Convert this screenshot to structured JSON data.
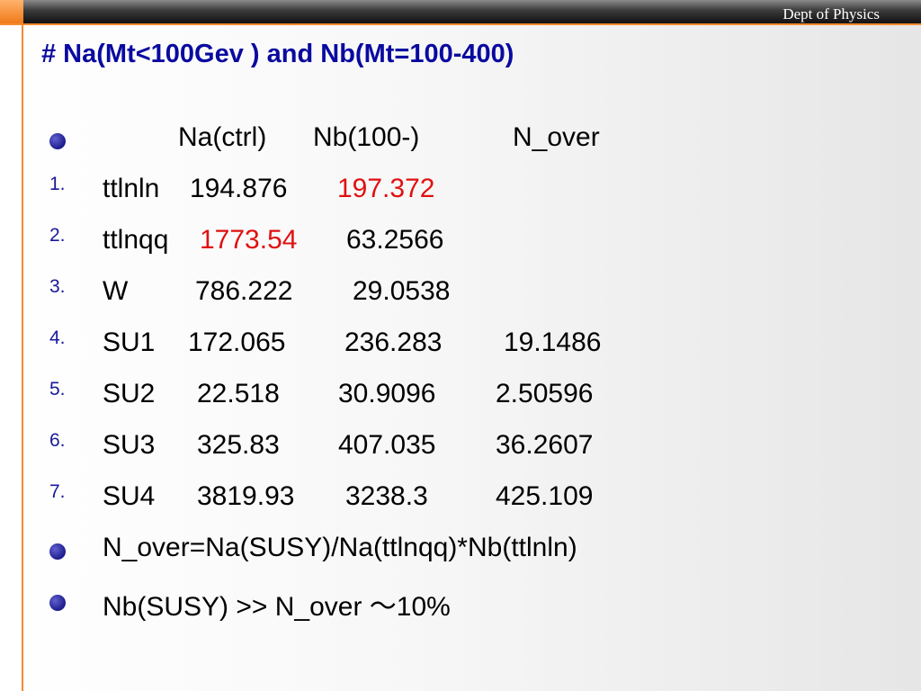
{
  "header": {
    "dept": "Dept of Physics"
  },
  "title": "# Na(Mt<100Gev ) and  Nb(Mt=100-400)",
  "colors": {
    "title": "#0a0aa0",
    "highlight": "#e01010",
    "accent": "#f58a2e"
  },
  "table_header": {
    "col1": "Na(ctrl)",
    "col2": "Nb(100-)",
    "col3": "N_over"
  },
  "rows": [
    {
      "number": "1.",
      "name": "ttlnln",
      "na": "194.876",
      "nb": "197.372",
      "nover": ""
    },
    {
      "number": "2.",
      "name": "ttlnqq",
      "na": "1773.54",
      "nb": "63.2566",
      "nover": ""
    },
    {
      "number": "3.",
      "name": "W",
      "na": "786.222",
      "nb": "29.0538",
      "nover": ""
    },
    {
      "number": "4.",
      "name": "SU1",
      "na": "172.065",
      "nb": "236.283",
      "nover": "19.1486"
    },
    {
      "number": "5.",
      "name": "SU2",
      "na": "22.518",
      "nb": "30.9096",
      "nover": "2.50596"
    },
    {
      "number": "6.",
      "name": "SU3",
      "na": "325.83",
      "nb": "407.035",
      "nover": "36.2607"
    },
    {
      "number": "7.",
      "name": "SU4",
      "na": "3819.93",
      "nb": "3238.3",
      "nover": "425.109"
    }
  ],
  "notes": [
    "N_over=Na(SUSY)/Na(ttlnqq)*Nb(ttlnln)",
    "Nb(SUSY) >> N_over ～10%"
  ]
}
